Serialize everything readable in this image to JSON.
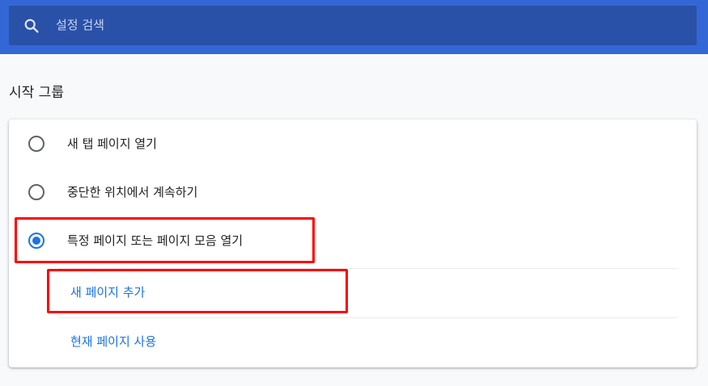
{
  "search": {
    "placeholder": "설정 검색",
    "icon": "search-icon"
  },
  "section": {
    "title": "시작 그룹"
  },
  "options": [
    {
      "label": "새 탭 페이지 열기",
      "checked": false
    },
    {
      "label": "중단한 위치에서 계속하기",
      "checked": false
    },
    {
      "label": "특정 페이지 또는 페이지 모음 열기",
      "checked": true
    }
  ],
  "links": {
    "add_page": "새 페이지 추가",
    "use_current": "현재 페이지 사용"
  },
  "colors": {
    "header": "#3367d6",
    "search_bg": "#2a51a8",
    "accent": "#1a73e8",
    "highlight": "#ff0000"
  }
}
